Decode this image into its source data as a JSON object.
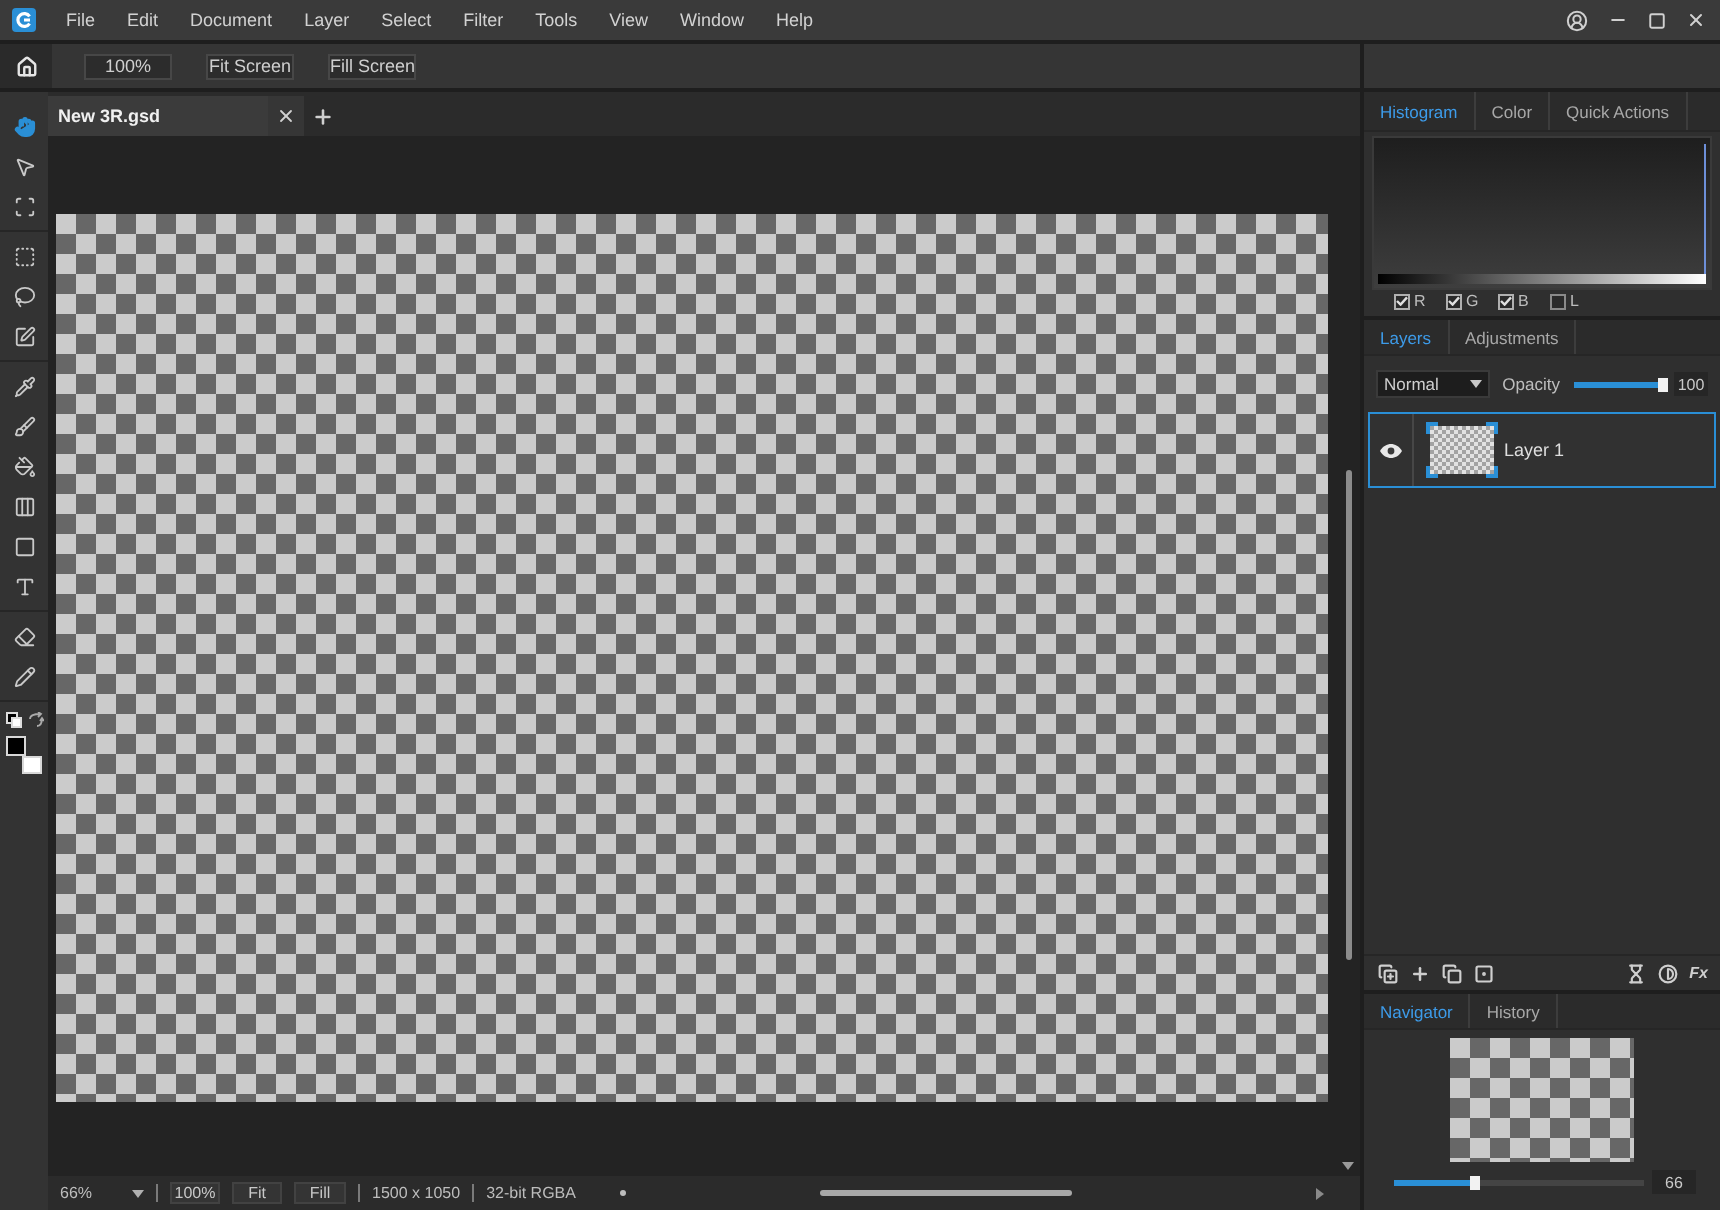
{
  "menu": [
    "File",
    "Edit",
    "Document",
    "Layer",
    "Select",
    "Filter",
    "Tools",
    "View",
    "Window",
    "Help"
  ],
  "options_bar": {
    "buttons": [
      "100%",
      "Fit Screen",
      "Fill Screen"
    ]
  },
  "tool_groups": [
    {
      "tools": [
        {
          "kind": "hand",
          "selected": true
        },
        {
          "kind": "pointer",
          "selected": false
        },
        {
          "kind": "transform",
          "selected": false
        }
      ]
    },
    {
      "tools": [
        {
          "kind": "marquee",
          "selected": false
        },
        {
          "kind": "lasso",
          "selected": false
        },
        {
          "kind": "quick_select",
          "selected": false
        }
      ]
    },
    {
      "tools": [
        {
          "kind": "eyedropper",
          "selected": false
        },
        {
          "kind": "brush",
          "selected": false
        },
        {
          "kind": "fill",
          "selected": false
        },
        {
          "kind": "gradient",
          "selected": false
        },
        {
          "kind": "shape",
          "selected": false
        },
        {
          "kind": "text",
          "selected": false
        }
      ]
    },
    {
      "tools": [
        {
          "kind": "eraser",
          "selected": false
        },
        {
          "kind": "pencil",
          "selected": false
        }
      ]
    }
  ],
  "colors": [
    {
      "kind": "foreground",
      "color": "#000000"
    },
    {
      "kind": "background",
      "color": "#ffffff"
    }
  ],
  "document_tabs": [
    {
      "label": "New 3R.gsd",
      "selected": true
    }
  ],
  "status_bar": {
    "zoom": "66%",
    "buttons": [
      "100%",
      "Fit",
      "Fill"
    ],
    "dimensions": "1500 x 1050",
    "color_mode": "32-bit RGBA"
  },
  "histogram_panel": {
    "tabs": [
      {
        "label": "Histogram",
        "selected": true
      },
      {
        "label": "Color",
        "selected": false
      },
      {
        "label": "Quick Actions",
        "selected": false
      }
    ],
    "channels": [
      {
        "label": "R",
        "checked": true
      },
      {
        "label": "G",
        "checked": true
      },
      {
        "label": "B",
        "checked": true
      },
      {
        "label": "L",
        "checked": false
      }
    ]
  },
  "layers_panel": {
    "tabs": [
      {
        "label": "Layers",
        "selected": true
      },
      {
        "label": "Adjustments",
        "selected": false
      }
    ],
    "blend_mode": "Normal",
    "opacity_label": "Opacity",
    "opacity": {
      "level": 1
    },
    "opacity_value": "100",
    "layers": [
      {
        "name": "Layer 1",
        "visible": true,
        "selected": true
      }
    ],
    "fx_label": "Fx"
  },
  "navigator_panel": {
    "tabs": [
      {
        "label": "Navigator",
        "selected": true
      },
      {
        "label": "History",
        "selected": false
      }
    ],
    "zoom": {
      "level": 0.32
    },
    "zoom_value": "66"
  }
}
